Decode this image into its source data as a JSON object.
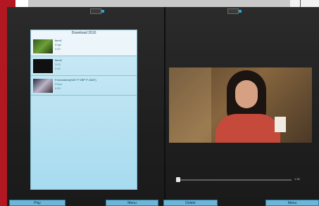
{
  "playlist": {
    "title": "Download 2010",
    "items": [
      {
        "title": "Item1",
        "line2": "Edge",
        "line3": "0:00"
      },
      {
        "title": "Item2",
        "line2": "3:03",
        "line3": "0:00"
      },
      {
        "title": "Forecasters(HAT P VBP P LBAT)",
        "line2": "Press",
        "line3": "0:00"
      }
    ]
  },
  "player": {
    "time": "1:30"
  },
  "progress": {
    "fraction": 0.02
  },
  "buttons": {
    "play": "Play",
    "menu1": "Menu",
    "delete": "Delete",
    "menu2": "Menu"
  },
  "colors": {
    "accent_red": "#b31822",
    "playlist_bg": "#a7dbef",
    "button_bg": "#6db6d8",
    "screen_bg": "#2b2b2b"
  }
}
